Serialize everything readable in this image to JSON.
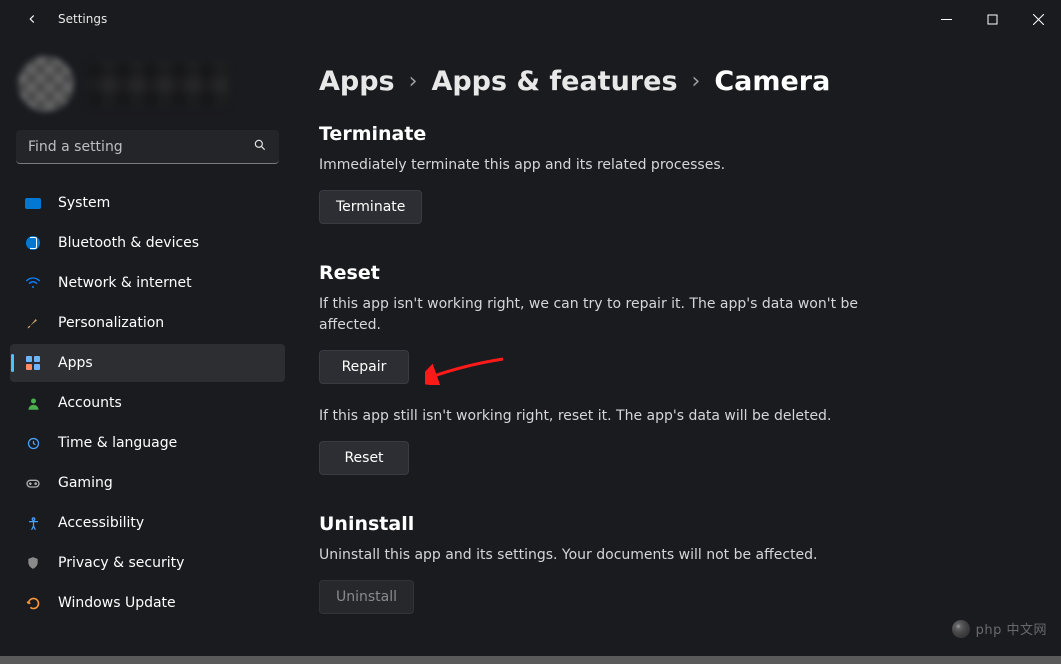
{
  "window": {
    "title": "Settings"
  },
  "search": {
    "placeholder": "Find a setting"
  },
  "sidebar": {
    "items": [
      {
        "label": "System"
      },
      {
        "label": "Bluetooth & devices"
      },
      {
        "label": "Network & internet"
      },
      {
        "label": "Personalization"
      },
      {
        "label": "Apps"
      },
      {
        "label": "Accounts"
      },
      {
        "label": "Time & language"
      },
      {
        "label": "Gaming"
      },
      {
        "label": "Accessibility"
      },
      {
        "label": "Privacy & security"
      },
      {
        "label": "Windows Update"
      }
    ]
  },
  "breadcrumb": {
    "level1": "Apps",
    "level2": "Apps & features",
    "level3": "Camera"
  },
  "sections": {
    "terminate": {
      "title": "Terminate",
      "desc": "Immediately terminate this app and its related processes.",
      "button": "Terminate"
    },
    "reset": {
      "title": "Reset",
      "desc1": "If this app isn't working right, we can try to repair it. The app's data won't be affected.",
      "repairButton": "Repair",
      "desc2": "If this app still isn't working right, reset it. The app's data will be deleted.",
      "resetButton": "Reset"
    },
    "uninstall": {
      "title": "Uninstall",
      "desc": "Uninstall this app and its settings. Your documents will not be affected.",
      "button": "Uninstall"
    }
  },
  "watermark": "php 中文网"
}
